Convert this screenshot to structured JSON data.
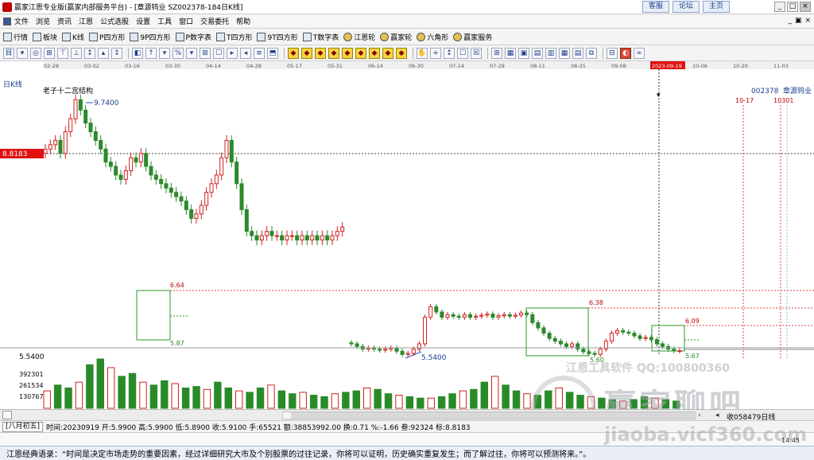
{
  "window": {
    "title": "赢家江恩专业版(赢家内部服务平台) - [章源钨业  SZ002378-184日K线]",
    "links": [
      "客服",
      "论坛",
      "主页"
    ],
    "controls": [
      "_",
      "□",
      "×"
    ]
  },
  "menu": {
    "items": [
      "文件",
      "浏览",
      "资讯",
      "江恩",
      "公式选股",
      "设置",
      "工具",
      "窗口",
      "交易委托",
      "帮助"
    ],
    "mini_controls": [
      "_",
      "▣",
      "×"
    ]
  },
  "toolbar": {
    "items": [
      {
        "label": "行情",
        "icon": "grid-icon"
      },
      {
        "label": "板块",
        "icon": "blocks-icon"
      },
      {
        "label": "K线",
        "icon": "kline-icon"
      },
      {
        "label": "P四方形",
        "icon": "square-icon"
      },
      {
        "label": "9P四方形",
        "icon": "square9-icon"
      },
      {
        "label": "P数字表",
        "icon": "table-icon"
      },
      {
        "label": "T四方形",
        "icon": "t-square-icon"
      },
      {
        "label": "9T四方形",
        "icon": "t9-square-icon"
      },
      {
        "label": "T数字表",
        "icon": "t-table-icon"
      },
      {
        "label": "江恩轮",
        "icon": "wheel-icon"
      },
      {
        "label": "赢家轮",
        "icon": "winner-wheel-icon"
      },
      {
        "label": "六角形",
        "icon": "hexagon-icon"
      },
      {
        "label": "赢家服务",
        "icon": "service-icon"
      }
    ]
  },
  "drawing_tools": {
    "glyphs": [
      "目",
      "▾",
      "◎",
      "⊞",
      "⊤",
      "⊥",
      "↕",
      "▴",
      "↕",
      "◧",
      "↑",
      "▾",
      "%",
      "▾",
      "⊞",
      "☐",
      "▸",
      "◂",
      "≡",
      "⬒",
      "◆",
      "◆",
      "◆",
      "◆",
      "◆",
      "◆",
      "◆",
      "◆",
      "◆",
      "✋",
      "+",
      "↕",
      "☐",
      "☒",
      "⊞",
      "▦",
      "▣",
      "▤",
      "▥",
      "▦",
      "▤",
      "⧉",
      "⊟",
      "◐",
      "∞"
    ]
  },
  "chart": {
    "period_label": "日K线",
    "study_label": "老子十二宫结构",
    "stock_code": "002378",
    "stock_name": "章源钨业",
    "date_axis": [
      "02-28",
      "03-02",
      "03-16",
      "03-30",
      "04-14",
      "04-28",
      "05-17",
      "05-31",
      "06-14",
      "06-30",
      "07-14",
      "07-28",
      "08-11",
      "08-25",
      "09-08",
      "2023-09-19",
      "10-06",
      "10-20",
      "11-03"
    ],
    "cursor_date": "2023-09-19",
    "cursor_value": "8.8183",
    "price_high_label": "9.7400",
    "price_low_label": "5.5400",
    "axis_low": "5.5400",
    "marker_labels": [
      "10-17",
      "10301"
    ],
    "level_labels": [
      "6.64",
      "5.87",
      "6.38",
      "5.60",
      "6.09",
      "5.67"
    ],
    "volume_axis": [
      "392301",
      "261534",
      "130767"
    ]
  },
  "chart_data": {
    "type": "candlestick",
    "series": [
      {
        "name": "upper-session",
        "values": [
          8.6,
          8.7,
          8.8,
          8.5,
          9.0,
          9.3,
          9.74,
          9.5,
          9.2,
          9.0,
          8.8,
          8.6,
          8.3,
          8.2,
          8.0,
          7.9,
          8.1,
          8.4,
          8.3,
          8.5,
          8.2,
          8.0,
          7.9,
          7.8,
          7.7,
          7.6,
          7.5,
          7.4,
          7.2,
          7.0,
          7.1,
          7.3,
          7.6,
          7.8,
          8.0,
          8.4,
          8.8,
          8.3,
          7.8,
          7.2,
          6.7,
          6.6,
          6.5,
          6.6,
          6.7,
          6.6,
          6.6,
          6.5,
          6.6,
          6.6,
          6.5,
          6.6,
          6.5,
          6.6,
          6.5,
          6.6,
          6.5,
          6.6,
          6.7,
          6.8
        ]
      },
      {
        "name": "lower-session",
        "values": [
          5.8,
          5.75,
          5.7,
          5.72,
          5.7,
          5.68,
          5.7,
          5.72,
          5.66,
          5.6,
          5.62,
          5.7,
          5.8,
          6.3,
          6.5,
          6.4,
          6.3,
          6.35,
          6.32,
          6.3,
          6.35,
          6.3,
          6.32,
          6.34,
          6.36,
          6.3,
          6.33,
          6.35,
          6.32,
          6.34,
          6.38,
          6.35,
          6.2,
          6.1,
          6.0,
          5.9,
          5.85,
          5.8,
          5.75,
          5.8,
          5.7,
          5.65,
          5.62,
          5.6,
          5.7,
          5.85,
          6.0,
          6.05,
          6.02,
          6.0,
          5.95,
          5.9,
          5.92,
          5.88,
          5.8,
          5.75,
          5.7,
          5.67,
          5.67
        ]
      },
      {
        "name": "volume",
        "values": [
          60,
          80,
          70,
          90,
          150,
          170,
          140,
          110,
          120,
          90,
          80,
          95,
          85,
          70,
          75,
          65,
          90,
          70,
          60,
          55,
          70,
          80,
          60,
          50,
          55,
          45,
          40,
          50,
          55,
          60,
          70,
          65,
          50,
          45,
          40,
          35,
          35,
          40,
          50,
          60,
          65,
          90,
          110,
          80,
          60,
          50,
          45,
          60,
          70,
          55,
          45,
          40,
          35,
          30,
          25,
          30,
          40,
          35,
          30,
          25
        ]
      }
    ],
    "levels": [
      6.64,
      5.87,
      6.38,
      5.6,
      6.09,
      5.67
    ],
    "ylim": [
      5.5,
      9.8
    ]
  },
  "status": {
    "lunar": "[八月初五]",
    "text": "时间:20230919 开:5.9900 高:5.9900 低:5.8900 收:5.9100 手:65521 额:38853992.00 换:0.71 %:-1.66 叁:92324 标:8.8183"
  },
  "scroll": {
    "code_text": "收058479日线"
  },
  "clock": "14:45",
  "footer": {
    "quote": "江恩经典语录：“时间是决定市场走势的重要因素，经过详细研究大市及个别股票的过往记录，你将可以证明，历史确实重复发生；而了解过往，你将可以预测将来。”。"
  },
  "watermark": {
    "line1": "江恩工具软件  QQ:100800360",
    "line2": "赢家聊吧",
    "line3": "jiaoba.vicf360.com"
  }
}
